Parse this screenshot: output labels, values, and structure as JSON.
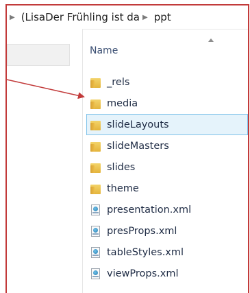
{
  "address": {
    "segments": [
      "(LisaDer Frühling ist da",
      "ppt"
    ]
  },
  "column": {
    "name_header": "Name"
  },
  "items": [
    {
      "name": "_rels",
      "type": "folder",
      "selected": false
    },
    {
      "name": "media",
      "type": "folder",
      "selected": false
    },
    {
      "name": "slideLayouts",
      "type": "folder",
      "selected": true
    },
    {
      "name": "slideMasters",
      "type": "folder",
      "selected": false
    },
    {
      "name": "slides",
      "type": "folder",
      "selected": false
    },
    {
      "name": "theme",
      "type": "folder",
      "selected": false
    },
    {
      "name": "presentation.xml",
      "type": "xml",
      "selected": false
    },
    {
      "name": "presProps.xml",
      "type": "xml",
      "selected": false
    },
    {
      "name": "tableStyles.xml",
      "type": "xml",
      "selected": false
    },
    {
      "name": "viewProps.xml",
      "type": "xml",
      "selected": false
    }
  ],
  "colors": {
    "annotation": "#c23a3a",
    "selection": "#e5f3fb",
    "selection_border": "#7fc2ea"
  }
}
